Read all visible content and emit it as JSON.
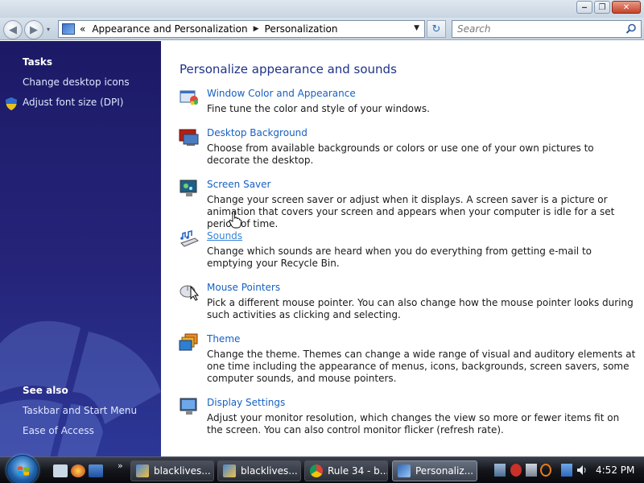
{
  "window": {
    "controls": {
      "minimize": "‒",
      "maximize": "❐",
      "close": "✕"
    }
  },
  "nav": {
    "back_glyph": "◀",
    "forward_glyph": "▶",
    "recent_glyph": "▾",
    "breadcrumb_prefix": "«",
    "breadcrumb": [
      "Appearance and Personalization",
      "Personalization"
    ],
    "breadcrumb_separator": "▶",
    "dropdown_glyph": "▼",
    "refresh_glyph": "↻",
    "search_placeholder": "Search"
  },
  "sidebar": {
    "tasks_heading": "Tasks",
    "tasks": [
      "Change desktop icons",
      "Adjust font size (DPI)"
    ],
    "see_also_heading": "See also",
    "see_also": [
      "Taskbar and Start Menu",
      "Ease of Access"
    ]
  },
  "main": {
    "title": "Personalize appearance and sounds",
    "items": [
      {
        "label": "Window Color and Appearance",
        "description": "Fine tune the color and style of your windows.",
        "icon": "window-color-icon"
      },
      {
        "label": "Desktop Background",
        "description": "Choose from available backgrounds or colors or use one of your own pictures to decorate the desktop.",
        "icon": "desktop-background-icon"
      },
      {
        "label": "Screen Saver",
        "description": "Change your screen saver or adjust when it displays. A screen saver is a picture or animation that covers your screen and appears when your computer is idle for a set period of time.",
        "icon": "screen-saver-icon"
      },
      {
        "label": "Sounds",
        "description": "Change which sounds are heard when you do everything from getting e-mail to emptying your Recycle Bin.",
        "icon": "sounds-icon"
      },
      {
        "label": "Mouse Pointers",
        "description": "Pick a different mouse pointer. You can also change how the mouse pointer looks during such activities as clicking and selecting.",
        "icon": "mouse-pointer-icon"
      },
      {
        "label": "Theme",
        "description": "Change the theme. Themes can change a wide range of visual and auditory elements at one time including the appearance of menus, icons, backgrounds, screen savers, some computer sounds, and mouse pointers.",
        "icon": "theme-icon"
      },
      {
        "label": "Display Settings",
        "description": "Adjust your monitor resolution, which changes the view so more or fewer items fit on the screen. You can also control monitor flicker (refresh rate).",
        "icon": "display-settings-icon"
      }
    ]
  },
  "taskbar": {
    "quicklaunch_more": "»",
    "buttons": [
      {
        "label": "blacklives...",
        "active": false
      },
      {
        "label": "blacklives...",
        "active": false
      },
      {
        "label": "Rule 34 - b...",
        "active": false
      },
      {
        "label": "Personaliz...",
        "active": true
      }
    ],
    "clock": "4:52 PM"
  },
  "colors": {
    "sidebar_bg": "#1c1a66",
    "link": "#1660c2",
    "title": "#1e3287",
    "taskbar": "#14161b"
  }
}
